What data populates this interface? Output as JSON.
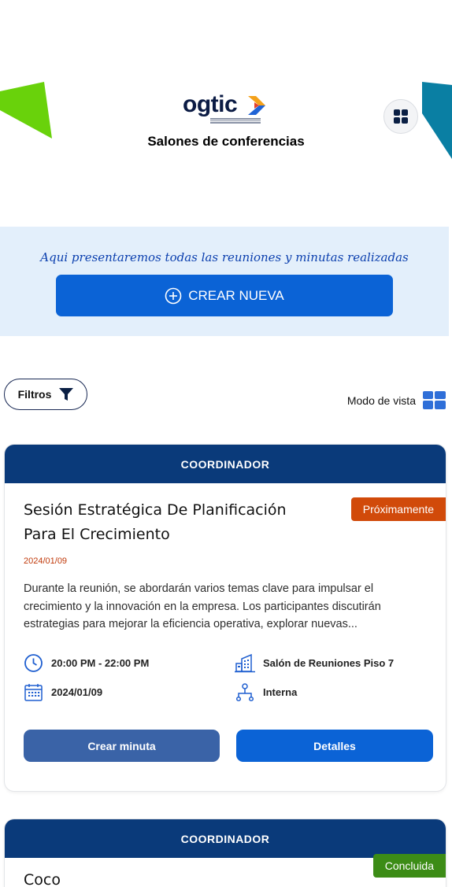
{
  "brand": {
    "logo_text": "ogtic",
    "accent_colors": [
      "#f4a11a",
      "#e4412b",
      "#1f63d6"
    ],
    "corner_left_color": "#69d20b",
    "corner_right_color": "#0a7fa3"
  },
  "header": {
    "title": "Salones de conferencias",
    "menu_icon": "grid-icon"
  },
  "banner": {
    "text": "Aqui presentaremos todas las reuniones y minutas realizadas",
    "create_button": "CREAR NUEVA",
    "create_icon": "plus-circle-icon"
  },
  "toolbar": {
    "filters_label": "Filtros",
    "filters_icon": "filter-icon",
    "view_mode_label": "Modo de vista",
    "view_mode_icon": "view-grid-icon"
  },
  "meetings": [
    {
      "role": "COORDINADOR",
      "title": "Sesión Estratégica De Planificación Para El Crecimiento",
      "status": "Próximamente",
      "status_color": "#d14a0a",
      "date": "2024/01/09",
      "description": "Durante la reunión, se abordarán varios temas clave para impulsar el crecimiento y la innovación en la empresa. Los participantes discutirán estrategias para mejorar la eficiencia operativa, explorar nuevas...",
      "time": "20:00 PM - 22:00 PM",
      "calendar_date": "2024/01/09",
      "room": "Salón de Reuniones Piso 7",
      "type": "Interna",
      "create_minute_button": "Crear minuta",
      "details_button": "Detalles"
    },
    {
      "role": "COORDINADOR",
      "title": "Coco",
      "status": "Concluida",
      "status_color": "#3c8c16"
    }
  ]
}
